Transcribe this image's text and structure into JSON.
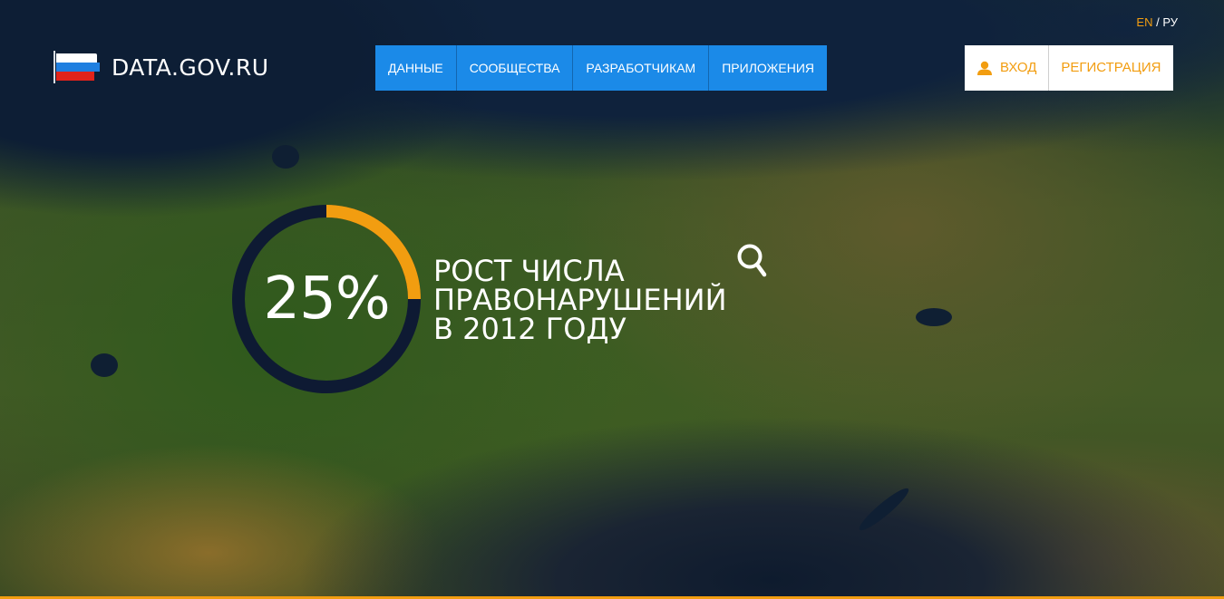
{
  "brand": {
    "name": "DATA.GOV.RU",
    "flag_colors": [
      "#ffffff",
      "#1f7fe0",
      "#e2231a"
    ]
  },
  "nav": {
    "items": [
      {
        "label": "ДАННЫЕ"
      },
      {
        "label": "СООБЩЕСТВА"
      },
      {
        "label": "РАЗРАБОТЧИКАМ"
      },
      {
        "label": "ПРИЛОЖЕНИЯ"
      }
    ]
  },
  "lang": {
    "en": "EN",
    "separator": "/",
    "ru": "РУ",
    "active": "EN"
  },
  "auth": {
    "login_label": "ВХОД",
    "login_icon": "user-icon",
    "register_label": "РЕГИСТРАЦИЯ"
  },
  "stat": {
    "value_label": "25%",
    "progress": 0.25,
    "headline": [
      "РОСТ ЧИСЛА",
      "ПРАВОНАРУШЕНИЙ",
      "В 2012 ГОДУ"
    ]
  },
  "search": {
    "icon": "search-icon"
  },
  "colors": {
    "accent": "#f29d10",
    "nav_blue": "#1b8ae8",
    "ring_track": "#0e1a33"
  }
}
